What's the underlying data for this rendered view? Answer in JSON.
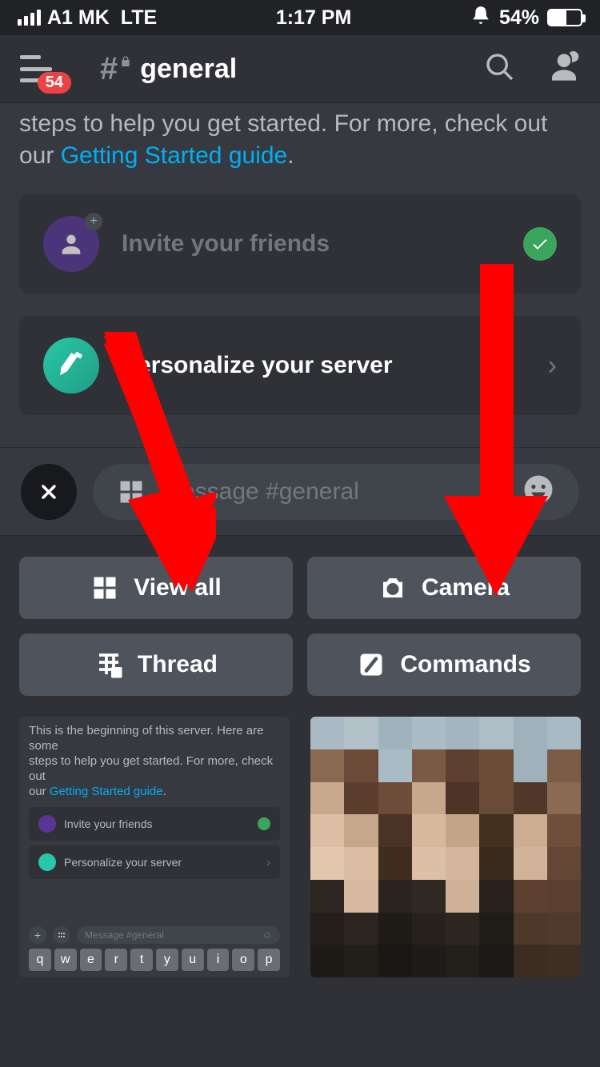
{
  "status": {
    "carrier": "A1 MK",
    "network": "LTE",
    "time": "1:17 PM",
    "battery_percent": "54%"
  },
  "header": {
    "badge": "54",
    "channel_name": "general"
  },
  "content": {
    "welcome_fragment": "steps to help you get started. For more, check out our ",
    "welcome_link": "Getting Started guide",
    "welcome_period": "."
  },
  "cards": {
    "invite_label": "Invite your friends",
    "personalize_label": "Personalize your server"
  },
  "input": {
    "placeholder": "Message #general"
  },
  "panel_buttons": {
    "view_all": "View all",
    "camera": "Camera",
    "thread": "Thread",
    "commands": "Commands"
  },
  "mini": {
    "line1": "This is the beginning of this server. Here are some",
    "line2": "steps to help you get started. For more, check out",
    "line3a": "our ",
    "line3b": "Getting Started guide",
    "line3c": ".",
    "card1": "Invite your friends",
    "card2": "Personalize your server",
    "placeholder": "Message #general",
    "keys": [
      "q",
      "w",
      "e",
      "r",
      "t",
      "y",
      "u",
      "i",
      "o",
      "p"
    ]
  },
  "colors": {
    "accent_red": "#ed4245",
    "accent_green": "#3ba55d",
    "link_blue": "#00aff4"
  }
}
